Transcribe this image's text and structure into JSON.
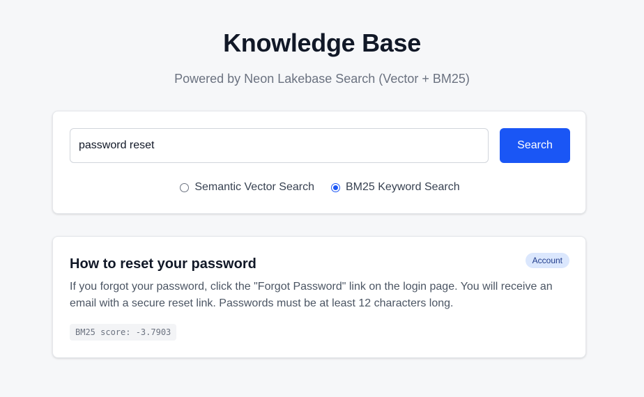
{
  "header": {
    "title": "Knowledge Base",
    "subtitle": "Powered by Neon Lakebase Search (Vector + BM25)"
  },
  "search": {
    "query_value": "password reset",
    "button_label": "Search",
    "modes": [
      {
        "label": "Semantic Vector Search",
        "selected": false
      },
      {
        "label": "BM25 Keyword Search",
        "selected": true
      }
    ]
  },
  "results": [
    {
      "title": "How to reset your password",
      "category": "Account",
      "body": "If you forgot your password, click the \"Forgot Password\" link on the login page. You will receive an email with a secure reset link. Passwords must be at least 12 characters long.",
      "score_text": "BM25 score: -3.7903"
    }
  ],
  "colors": {
    "accent": "#1a56f5",
    "background": "#f6f7f9",
    "badge_bg": "#dbe7fd",
    "badge_text": "#1e3a8a"
  }
}
